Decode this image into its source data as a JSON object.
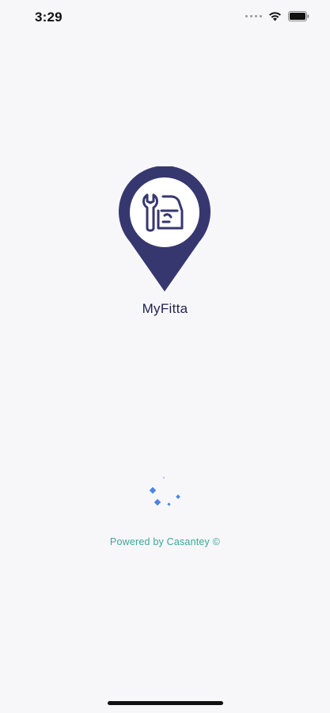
{
  "status_bar": {
    "time": "3:29",
    "wifi_icon": "wifi-icon",
    "battery_icon": "battery-icon"
  },
  "splash": {
    "logo_icon": "map-pin-wrench-car-icon",
    "app_name": "MyFitta",
    "loader_icon": "loading-spinner-icon",
    "powered_by": "Powered by Casantey ©"
  },
  "colors": {
    "brand": "#373770",
    "app_name": "#1f2050",
    "powered_by": "#3aa89a",
    "loader": "#4a84e8",
    "background": "#f7f7f9"
  }
}
